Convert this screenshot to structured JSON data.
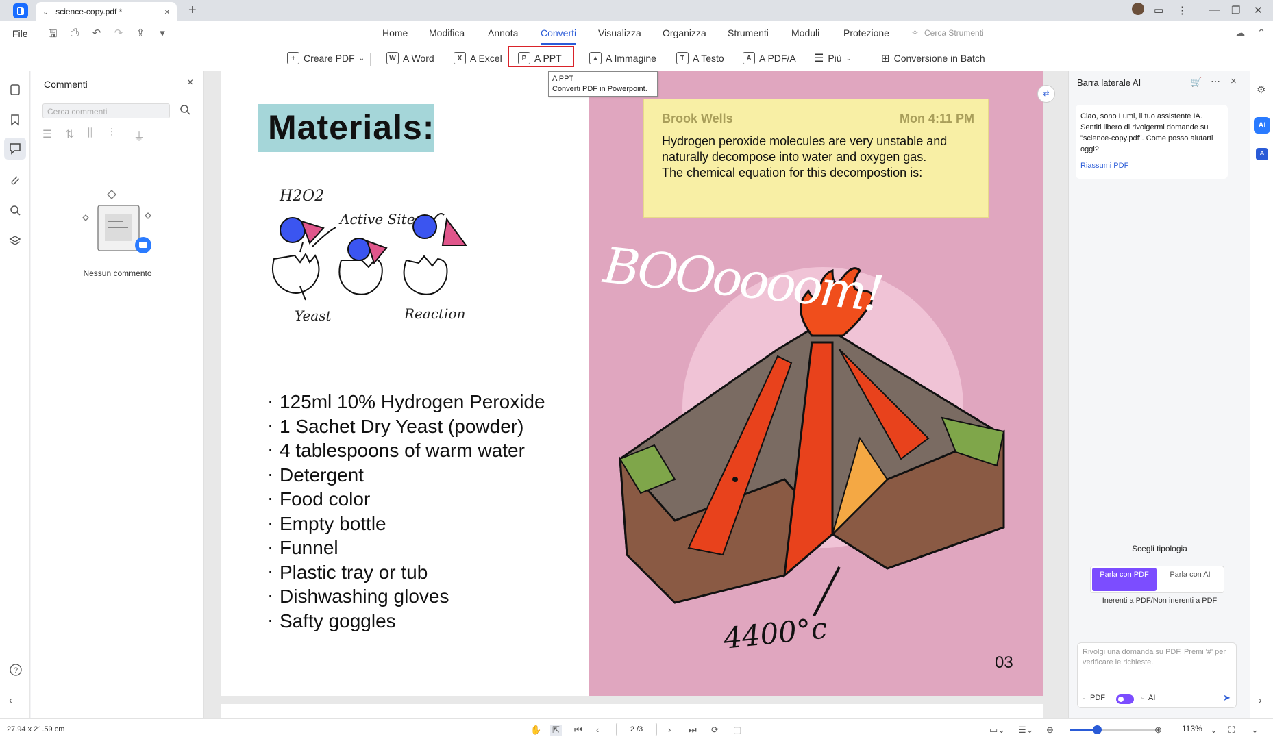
{
  "tab": {
    "title": "science-copy.pdf *"
  },
  "menubar": {
    "file": "File",
    "items": [
      "Home",
      "Modifica",
      "Annota",
      "Converti",
      "Visualizza",
      "Organizza",
      "Strumenti",
      "Moduli",
      "Protezione"
    ],
    "active": "Converti",
    "search_tools": "Cerca Strumenti"
  },
  "toolbar": {
    "create_pdf": "Creare PDF",
    "to_word": "A Word",
    "to_excel": "A Excel",
    "to_ppt": "A PPT",
    "to_image": "A Immagine",
    "to_text": "A Testo",
    "to_pdfa": "A PDF/A",
    "more": "Più",
    "batch": "Conversione in Batch"
  },
  "tooltip": {
    "title": "A PPT",
    "desc": "Converti PDF in Powerpoint."
  },
  "comments": {
    "title": "Commenti",
    "search_placeholder": "Cerca commenti",
    "empty": "Nessun commento"
  },
  "document": {
    "title": "Materials:",
    "diagram_labels": {
      "h2o2": "H2O2",
      "active_site": "Active Site",
      "yeast": "Yeast",
      "reaction": "Reaction"
    },
    "materials": [
      "125ml 10% Hydrogen Peroxide",
      "1 Sachet Dry Yeast (powder)",
      "4 tablespoons of warm water",
      "Detergent",
      "Food color",
      "Empty bottle",
      "Funnel",
      "Plastic tray or tub",
      "Dishwashing gloves",
      "Safty goggles"
    ],
    "note": {
      "author": "Brook Wells",
      "time": "Mon 4:11 PM",
      "lines": [
        "Hydrogen peroxide molecules are very unstable and",
        "naturally decompose into water and oxygen gas.",
        "The chemical equation for this decompostion is:"
      ]
    },
    "boom": "BOOoooom!",
    "temperature": "4400°c",
    "page_number": "03"
  },
  "ai_sidebar": {
    "title": "Barra laterale AI",
    "message": "Ciao, sono Lumi, il tuo assistente IA. Sentiti libero di rivolgermi domande su \"science-copy.pdf\". Come posso aiutarti oggi?",
    "summarize_link": "Riassumi PDF",
    "choose_type": "Scegli tipologia",
    "option_pdf": "Parla con PDF",
    "option_ai": "Parla con AI",
    "scope": "Inerenti a PDF/Non inerenti a PDF",
    "input_placeholder": "Rivolgi una domanda su PDF. Premi '#' per verificare le richieste.",
    "toggle_left": "PDF",
    "toggle_right": "AI"
  },
  "status": {
    "dimensions": "27.94 x 21.59 cm",
    "page": "2 /3",
    "zoom": "113%",
    "zoom_level": 0.3
  },
  "colors": {
    "accent": "#2a5bd7",
    "ai_purple": "#7c4dff",
    "highlight_red": "#d9232a",
    "page_pink": "#e0a6bf",
    "title_box": "#a5d6d9",
    "note_yellow": "#f8efa5"
  }
}
